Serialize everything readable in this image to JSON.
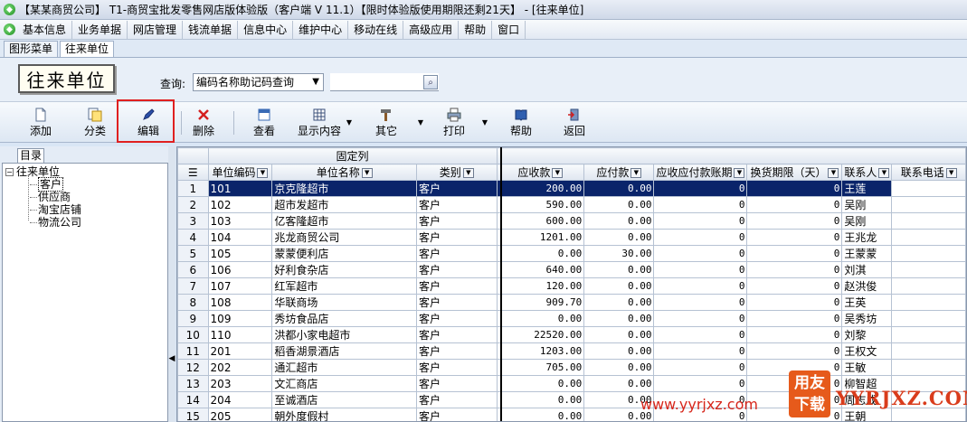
{
  "window": {
    "title": "【某某商贸公司】 T1-商贸宝批发零售网店版体验版（客户端 V 11.1）【限时体验版使用期限还剩21天】 - [往来单位]"
  },
  "menu": [
    "基本信息",
    "业务单据",
    "网店管理",
    "钱流单据",
    "信息中心",
    "维护中心",
    "移动在线",
    "高级应用",
    "帮助",
    "窗口"
  ],
  "tabs": [
    {
      "label": "图形菜单"
    },
    {
      "label": "往来单位"
    }
  ],
  "page_title": "往来单位",
  "query": {
    "label": "查询:",
    "selected": "编码名称助记码查询",
    "value": ""
  },
  "toolbar": {
    "add": "添加",
    "category": "分类",
    "edit": "编辑",
    "delete": "删除",
    "view": "查看",
    "display": "显示内容",
    "other": "其它",
    "print": "打印",
    "help": "帮助",
    "back": "返回"
  },
  "tree": {
    "tab": "目录",
    "root": "往来单位",
    "children": [
      "客户",
      "供应商",
      "淘宝店铺",
      "物流公司"
    ]
  },
  "grid": {
    "group_header": "固定列",
    "columns": [
      "单位编码",
      "单位名称",
      "类别",
      "应收款",
      "应付款",
      "应收应付款账期",
      "换货期限（天）",
      "联系人",
      "联系电话"
    ],
    "rows": [
      [
        "1",
        "101",
        "京克隆超市",
        "客户",
        "200.00",
        "0.00",
        "0",
        "0",
        "王莲",
        ""
      ],
      [
        "2",
        "102",
        "超市发超市",
        "客户",
        "590.00",
        "0.00",
        "0",
        "0",
        "吴刚",
        ""
      ],
      [
        "3",
        "103",
        "亿客隆超市",
        "客户",
        "600.00",
        "0.00",
        "0",
        "0",
        "吴刚",
        ""
      ],
      [
        "4",
        "104",
        "兆龙商贸公司",
        "客户",
        "1201.00",
        "0.00",
        "0",
        "0",
        "王兆龙",
        ""
      ],
      [
        "5",
        "105",
        "蒙蒙便利店",
        "客户",
        "0.00",
        "30.00",
        "0",
        "0",
        "王蒙蒙",
        ""
      ],
      [
        "6",
        "106",
        "好利食杂店",
        "客户",
        "640.00",
        "0.00",
        "0",
        "0",
        "刘淇",
        ""
      ],
      [
        "7",
        "107",
        "红军超市",
        "客户",
        "120.00",
        "0.00",
        "0",
        "0",
        "赵洪俊",
        ""
      ],
      [
        "8",
        "108",
        "华联商场",
        "客户",
        "909.70",
        "0.00",
        "0",
        "0",
        "王英",
        ""
      ],
      [
        "9",
        "109",
        "秀坊食品店",
        "客户",
        "0.00",
        "0.00",
        "0",
        "0",
        "吴秀坊",
        ""
      ],
      [
        "10",
        "110",
        "洪都小家电超市",
        "客户",
        "22520.00",
        "0.00",
        "0",
        "0",
        "刘黎",
        ""
      ],
      [
        "11",
        "201",
        "稻香湖景酒店",
        "客户",
        "1203.00",
        "0.00",
        "0",
        "0",
        "王权文",
        ""
      ],
      [
        "12",
        "202",
        "通汇超市",
        "客户",
        "705.00",
        "0.00",
        "0",
        "0",
        "王敏",
        ""
      ],
      [
        "13",
        "203",
        "文汇商店",
        "客户",
        "0.00",
        "0.00",
        "0",
        "0",
        "柳智超",
        ""
      ],
      [
        "14",
        "204",
        "至诚酒店",
        "客户",
        "0.00",
        "0.00",
        "0",
        "0",
        "周志成",
        ""
      ],
      [
        "15",
        "205",
        "朝外度假村",
        "客户",
        "0.00",
        "0.00",
        "0",
        "0",
        "王朝",
        ""
      ]
    ]
  },
  "watermark": {
    "badge_line1": "用友",
    "badge_line2": "下载",
    "text": "YYRJXZ.COM",
    "url": "www.yyrjxz.com"
  }
}
